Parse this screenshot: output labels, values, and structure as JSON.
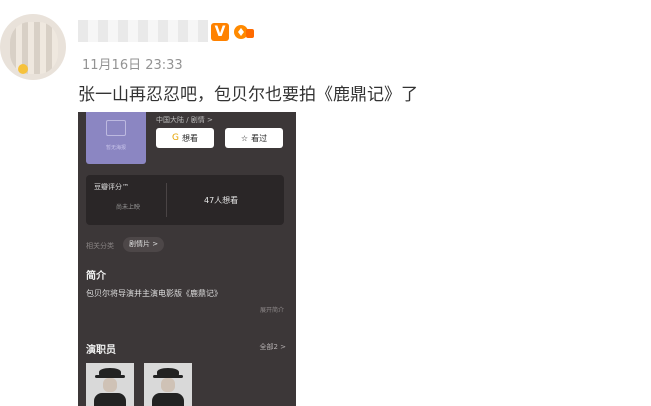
{
  "post": {
    "timestamp": "11月16日 23:33",
    "text": "张一山再忍忍吧，包贝尔也要拍《鹿鼎记》了",
    "verified_badge": "V"
  },
  "screenshot": {
    "poster_text": "暂无海报",
    "genre": "中国大陆 / 剧情 >",
    "want_button": "想看",
    "seen_button": "看过",
    "rating_label": "豆瓣评分™",
    "rating_status": "尚未上映",
    "want_count": "47人想看",
    "related_label": "相关分类",
    "tag": "剧情片 >",
    "intro_title": "简介",
    "intro_text": "包贝尔将导演并主演电影版《鹿鼎记》",
    "intro_more": "展开简介",
    "cast_title": "演职员",
    "cast_all": "全部2 >"
  },
  "colors": {
    "verified": "#ff8200",
    "poster_bg": "#8b86c2",
    "panel_bg": "#3c3738"
  }
}
